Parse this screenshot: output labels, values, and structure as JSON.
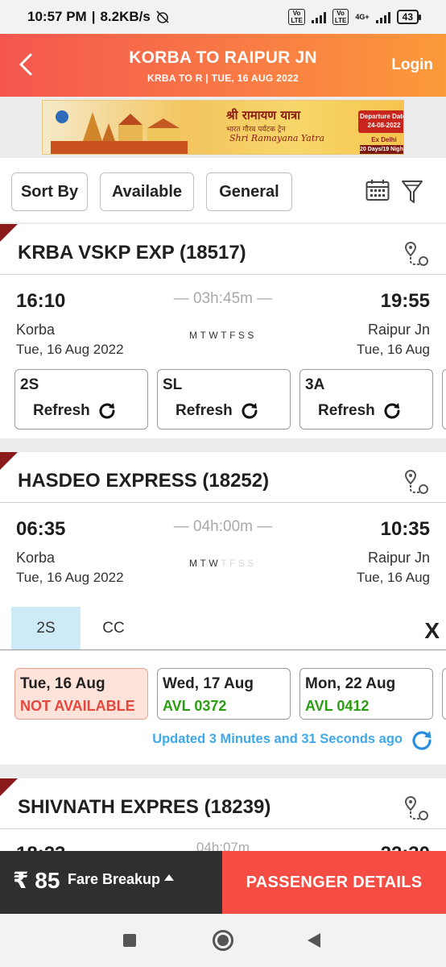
{
  "status_bar": {
    "time": "10:57 PM",
    "speed": "8.2KB/s",
    "network_label": "4G+",
    "volte_label": "Vo LTE",
    "battery": "43"
  },
  "header": {
    "title": "KORBA TO RAIPUR JN",
    "subtitle": "KRBA TO R | TUE, 16 AUG  2022",
    "login": "Login"
  },
  "banner": {
    "title_hi": "श्री रामायण यात्रा",
    "subtitle_hi": "भारत गौरव पर्यटक ट्रेन",
    "name": "Shri Ramayana Yatra",
    "departure": "Departure Date: 24-08-2022",
    "ex": "Ex Delhi",
    "duration": "20 Days/19 Nights"
  },
  "filters": {
    "sort_by": "Sort By",
    "available": "Available",
    "general": "General"
  },
  "trains": [
    {
      "name": "KRBA VSKP EXP (18517)",
      "dep_time": "16:10",
      "arr_time": "19:55",
      "duration": "— 03h:45m —",
      "from": "Korba",
      "to": "Raipur Jn",
      "dep_date": "Tue, 16 Aug  2022",
      "arr_date": "Tue, 16 Aug",
      "days": [
        "M",
        "T",
        "W",
        "T",
        "F",
        "S",
        "S"
      ],
      "classes": [
        {
          "code": "2S",
          "action": "Refresh"
        },
        {
          "code": "SL",
          "action": "Refresh"
        },
        {
          "code": "3A",
          "action": "Refresh"
        }
      ]
    },
    {
      "name": "HASDEO EXPRESS (18252)",
      "dep_time": "06:35",
      "arr_time": "10:35",
      "duration": "— 04h:00m —",
      "from": "Korba",
      "to": "Raipur Jn",
      "dep_date": "Tue, 16 Aug  2022",
      "arr_date": "Tue, 16 Aug",
      "days_on": [
        "M",
        "T",
        "W"
      ],
      "days_off": [
        "T",
        "F",
        "S",
        "S"
      ],
      "tabs": [
        "2S",
        "CC"
      ],
      "close": "X",
      "availability": [
        {
          "date": "Tue, 16 Aug",
          "status": "NOT AVAILABLE"
        },
        {
          "date": "Wed, 17 Aug",
          "status": "AVL 0372"
        },
        {
          "date": "Mon, 22 Aug",
          "status": "AVL 0412"
        }
      ],
      "updated": "Updated 3 Minutes and 31 Seconds ago"
    },
    {
      "name": "SHIVNATH EXPRES (18239)",
      "dep_time": "18:23",
      "arr_time": "22:30",
      "duration": "04h:07m"
    }
  ],
  "bottom": {
    "fare": "₹ 85",
    "fare_breakup": "Fare Breakup",
    "passenger_details": "PASSENGER DETAILS"
  },
  "colors": {
    "header_start": "#f4564e",
    "header_end": "#fb9a3a",
    "accent_red": "#f54d44",
    "available_green": "#2a9d12",
    "not_available_red": "#e5473d",
    "updated_blue": "#3fa8e6",
    "tab_active": "#cfeaf7"
  }
}
